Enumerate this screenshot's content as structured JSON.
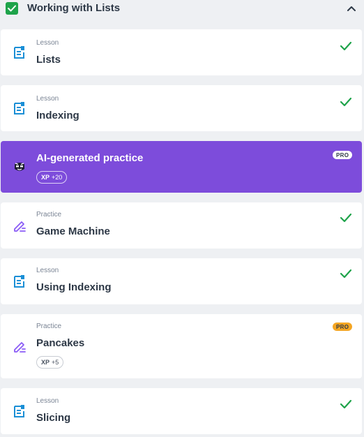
{
  "section": {
    "title": "Working with Lists",
    "colors": {
      "complete": "#1ea34a",
      "practice_icon": "#8b5cf6",
      "lesson_icon": "#1a8fd6",
      "ai_card": "#7d4cdb",
      "pro_badge": "#f5a623"
    }
  },
  "items": [
    {
      "kind": "Lesson",
      "title": "Lists",
      "icon": "lesson-icon",
      "completed": true
    },
    {
      "kind": "Lesson",
      "title": "Indexing",
      "icon": "lesson-icon",
      "completed": true
    },
    {
      "kind": "",
      "title": "AI-generated practice",
      "icon": "ai-mascot-icon",
      "xp_label": "XP",
      "xp_value": "+20",
      "badge": "PRO"
    },
    {
      "kind": "Practice",
      "title": "Game Machine",
      "icon": "practice-icon",
      "completed": true
    },
    {
      "kind": "Lesson",
      "title": "Using Indexing",
      "icon": "lesson-icon",
      "completed": true
    },
    {
      "kind": "Practice",
      "title": "Pancakes",
      "icon": "practice-icon",
      "xp_label": "XP",
      "xp_value": "+5",
      "badge": "PRO"
    },
    {
      "kind": "Lesson",
      "title": "Slicing",
      "icon": "lesson-icon",
      "completed": true
    }
  ]
}
